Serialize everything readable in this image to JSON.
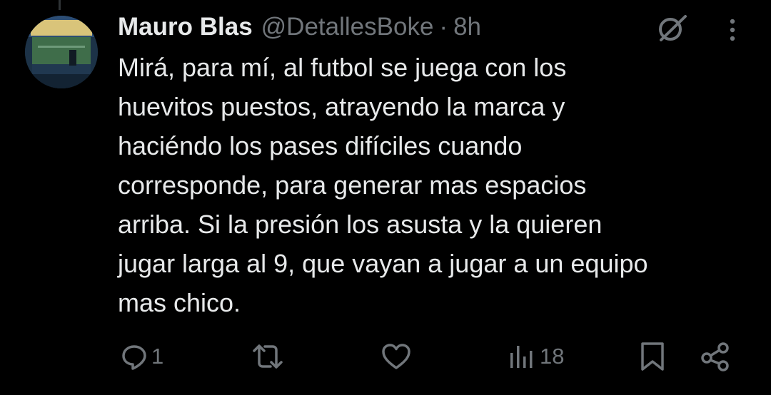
{
  "tweet": {
    "author_name": "Mauro Blas",
    "handle": "@DetallesBoke",
    "separator": "·",
    "time": "8h",
    "text_lines": [
      "Mirá, para mí, al futbol se juega con los",
      "huevitos puestos, atrayendo la marca y",
      "haciéndo los pases difíciles cuando",
      "corresponde, para generar mas espacios",
      "arriba. Si la presión los asusta y la quieren",
      "jugar larga al 9, que vayan a jugar a un equipo",
      "mas chico."
    ]
  },
  "actions": {
    "reply_count": "1",
    "views_count": "18"
  },
  "icons": {
    "reply": "reply-icon",
    "retweet": "retweet-icon",
    "like": "heart-icon",
    "views": "views-icon",
    "bookmark": "bookmark-icon",
    "share": "share-icon",
    "grok": "grok-icon",
    "more": "more-icon"
  },
  "colors": {
    "background": "#000000",
    "text_primary": "#e7e9ea",
    "text_secondary": "#71767b"
  }
}
